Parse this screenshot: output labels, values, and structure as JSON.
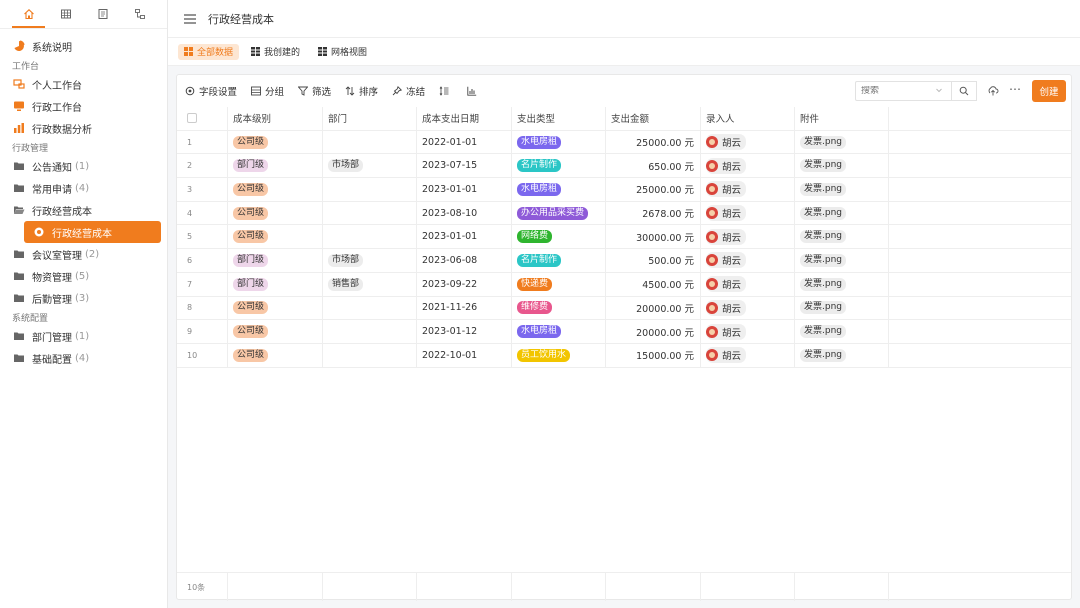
{
  "sidebar": {
    "tabs": [
      "home-icon",
      "table-icon",
      "doc-icon",
      "flow-icon"
    ],
    "items": [
      {
        "type": "item",
        "icon": "pie-icon",
        "label": "系统说明",
        "count": ""
      },
      {
        "type": "section",
        "label": "工作台"
      },
      {
        "type": "item",
        "icon": "user-desk-icon",
        "label": "个人工作台",
        "count": ""
      },
      {
        "type": "item",
        "icon": "monitor-icon",
        "label": "行政工作台",
        "count": ""
      },
      {
        "type": "item",
        "icon": "bar-chart-icon",
        "label": "行政数据分析",
        "count": ""
      },
      {
        "type": "section",
        "label": "行政管理"
      },
      {
        "type": "item",
        "icon": "folder-icon",
        "label": "公告通知",
        "count": "(1)"
      },
      {
        "type": "item",
        "icon": "folder-icon",
        "label": "常用申请",
        "count": "(4)"
      },
      {
        "type": "item",
        "icon": "folder-open-icon",
        "label": "行政经营成本",
        "count": ""
      },
      {
        "type": "active",
        "icon": "gear-icon",
        "label": "行政经营成本",
        "count": ""
      },
      {
        "type": "item",
        "icon": "folder-icon",
        "label": "会议室管理",
        "count": "(2)"
      },
      {
        "type": "item",
        "icon": "folder-icon",
        "label": "物资管理",
        "count": "(5)"
      },
      {
        "type": "item",
        "icon": "folder-icon",
        "label": "后勤管理",
        "count": "(3)"
      },
      {
        "type": "section",
        "label": "系统配置"
      },
      {
        "type": "item",
        "icon": "folder-icon",
        "label": "部门管理",
        "count": "(1)"
      },
      {
        "type": "item",
        "icon": "folder-icon",
        "label": "基础配置",
        "count": "(4)"
      }
    ]
  },
  "header": {
    "title": "行政经营成本"
  },
  "views": [
    {
      "label": "全部数据",
      "active": true
    },
    {
      "label": "我创建的",
      "active": false
    },
    {
      "label": "网格视图",
      "active": false
    }
  ],
  "toolbar": {
    "tools": [
      {
        "icon": "settings-icon",
        "label": "字段设置"
      },
      {
        "icon": "group-icon",
        "label": "分组"
      },
      {
        "icon": "filter-icon",
        "label": "筛选"
      },
      {
        "icon": "sort-icon",
        "label": "排序"
      },
      {
        "icon": "pin-icon",
        "label": "冻结"
      },
      {
        "icon": "row-height-icon",
        "label": ""
      },
      {
        "icon": "chart-icon",
        "label": ""
      }
    ],
    "search_placeholder": "搜索",
    "create_label": "创建"
  },
  "table": {
    "columns": [
      "成本级别",
      "部门",
      "成本支出日期",
      "支出类型",
      "支出金额",
      "录入人",
      "附件"
    ],
    "rows": [
      {
        "no": "1",
        "level": "公司级",
        "dept": "",
        "date": "2022-01-01",
        "type": "水电房租",
        "amount": "25000.00 元",
        "person": "胡云",
        "file": "发票.png"
      },
      {
        "no": "2",
        "level": "部门级",
        "dept": "市场部",
        "date": "2023-07-15",
        "type": "名片制作",
        "amount": "650.00 元",
        "person": "胡云",
        "file": "发票.png"
      },
      {
        "no": "3",
        "level": "公司级",
        "dept": "",
        "date": "2023-01-01",
        "type": "水电房租",
        "amount": "25000.00 元",
        "person": "胡云",
        "file": "发票.png"
      },
      {
        "no": "4",
        "level": "公司级",
        "dept": "",
        "date": "2023-08-10",
        "type": "办公用品采买费",
        "amount": "2678.00 元",
        "person": "胡云",
        "file": "发票.png"
      },
      {
        "no": "5",
        "level": "公司级",
        "dept": "",
        "date": "2023-01-01",
        "type": "网络费",
        "amount": "30000.00 元",
        "person": "胡云",
        "file": "发票.png"
      },
      {
        "no": "6",
        "level": "部门级",
        "dept": "市场部",
        "date": "2023-06-08",
        "type": "名片制作",
        "amount": "500.00 元",
        "person": "胡云",
        "file": "发票.png"
      },
      {
        "no": "7",
        "level": "部门级",
        "dept": "销售部",
        "date": "2023-09-22",
        "type": "快递费",
        "amount": "4500.00 元",
        "person": "胡云",
        "file": "发票.png"
      },
      {
        "no": "8",
        "level": "公司级",
        "dept": "",
        "date": "2021-11-26",
        "type": "维修费",
        "amount": "20000.00 元",
        "person": "胡云",
        "file": "发票.png"
      },
      {
        "no": "9",
        "level": "公司级",
        "dept": "",
        "date": "2023-01-12",
        "type": "水电房租",
        "amount": "20000.00 元",
        "person": "胡云",
        "file": "发票.png"
      },
      {
        "no": "10",
        "level": "公司级",
        "dept": "",
        "date": "2022-10-01",
        "type": "员工饮用水",
        "amount": "15000.00 元",
        "person": "胡云",
        "file": "发票.png"
      }
    ],
    "footer_count": "10条"
  },
  "colors": {
    "accent": "#f07c1e",
    "type_colors": {
      "水电房租": "#7b68ee",
      "名片制作": "#2bc6c6",
      "办公用品采买费": "#8e5ad8",
      "网络费": "#2fb52f",
      "快递费": "#f07c1e",
      "维修费": "#e8578d",
      "员工饮用水": "#f2c500"
    }
  }
}
